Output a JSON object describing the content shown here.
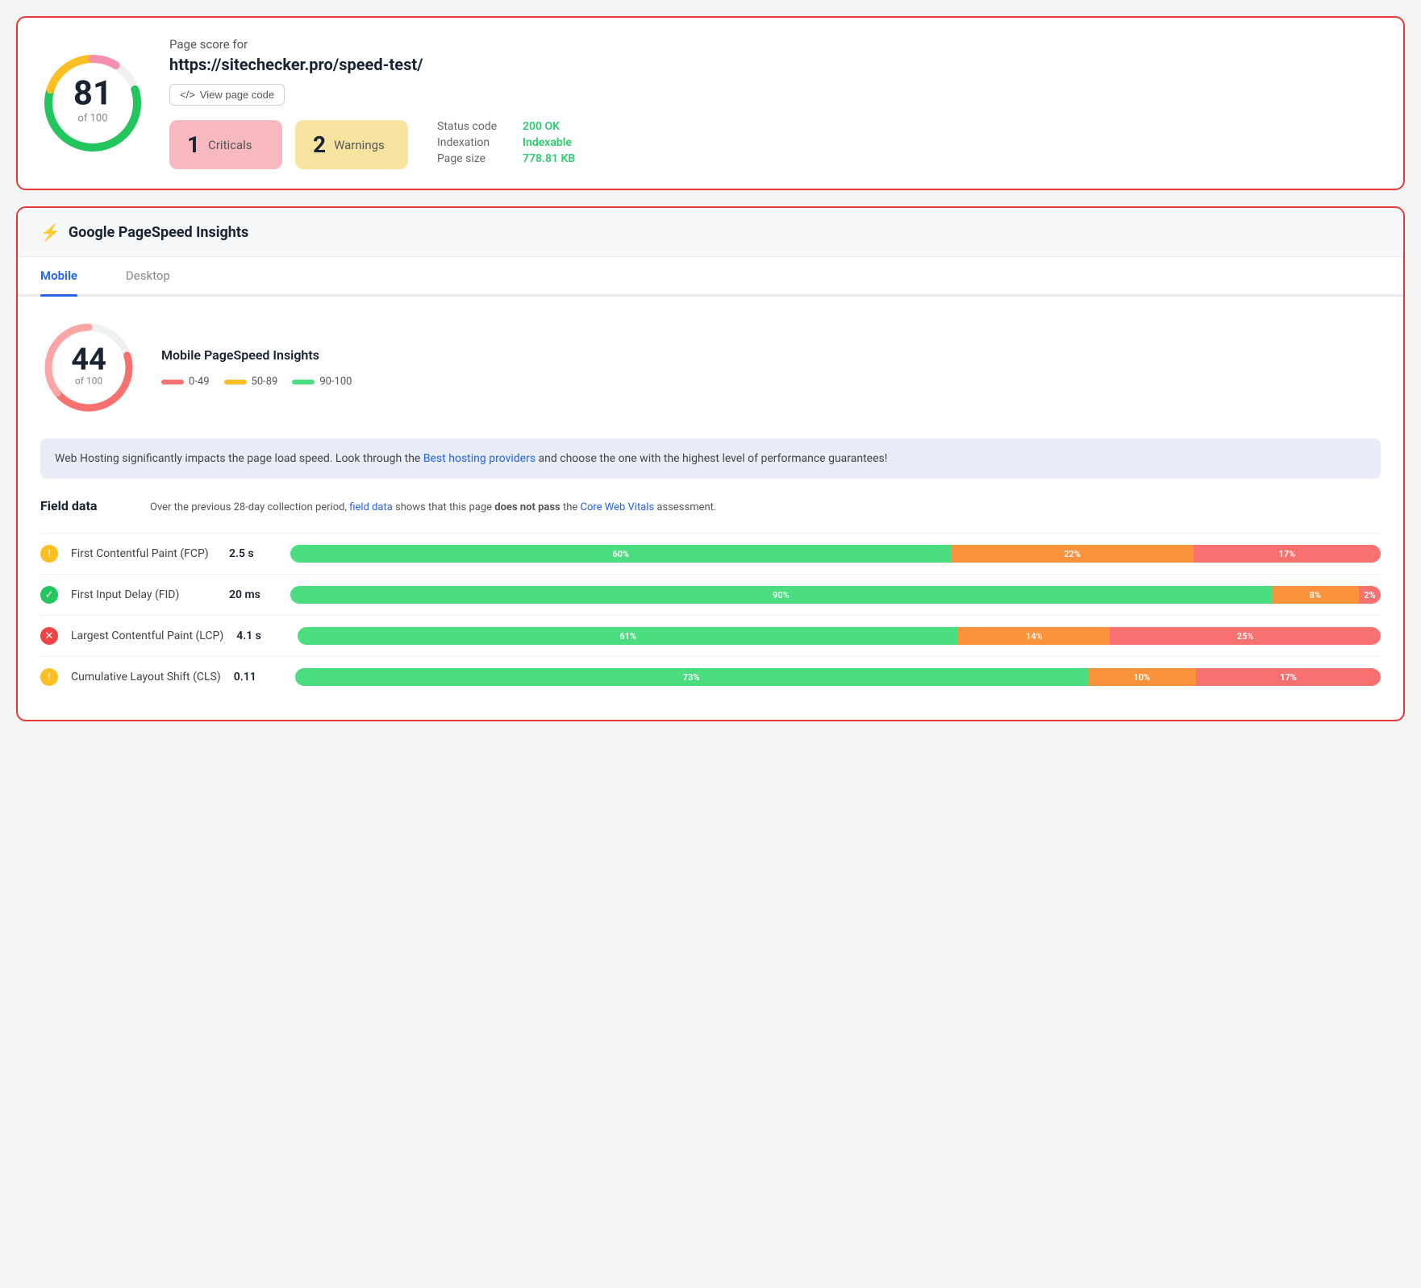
{
  "top_card": {
    "score": "81",
    "score_of": "of 100",
    "page_score_label": "Page score for",
    "page_url": "https://sitechecker.pro/speed-test/",
    "view_code_btn": "View page code",
    "criticals_count": "1",
    "criticals_label": "Criticals",
    "warnings_count": "2",
    "warnings_label": "Warnings",
    "status_code_label": "Status code",
    "status_code_value": "200 OK",
    "indexation_label": "Indexation",
    "indexation_value": "Indexable",
    "page_size_label": "Page size",
    "page_size_value": "778.81 KB"
  },
  "bottom_card": {
    "title": "Google PageSpeed Insights",
    "tabs": [
      {
        "label": "Mobile",
        "active": true
      },
      {
        "label": "Desktop",
        "active": false
      }
    ],
    "mobile_score": "44",
    "mobile_score_of": "of 100",
    "mobile_title": "Mobile PageSpeed Insights",
    "legend": [
      {
        "range": "0-49",
        "color": "#f87171"
      },
      {
        "range": "50-89",
        "color": "#fbbf24"
      },
      {
        "range": "90-100",
        "color": "#4ade80"
      }
    ],
    "info_box_text_1": "Web Hosting significantly impacts the page load speed. Look through the ",
    "info_box_link_text": "Best hosting providers",
    "info_box_text_2": " and choose the one with the highest level of performance guarantees!",
    "field_data_title": "Field data",
    "field_data_desc_1": "Over the previous 28-day collection period, ",
    "field_data_link": "field data",
    "field_data_desc_2": " shows that this page ",
    "field_data_bold": "does not pass",
    "field_data_desc_3": " the ",
    "field_data_link2": "Core Web Vitals",
    "field_data_desc_4": " assessment.",
    "metrics": [
      {
        "icon_type": "warning",
        "name": "First Contentful Paint (FCP)",
        "value": "2.5 s",
        "segments": [
          {
            "pct": 60,
            "label": "60%",
            "color": "green"
          },
          {
            "pct": 22,
            "label": "22%",
            "color": "orange"
          },
          {
            "pct": 17,
            "label": "17%",
            "color": "red"
          }
        ]
      },
      {
        "icon_type": "success",
        "name": "First Input Delay (FID)",
        "value": "20 ms",
        "segments": [
          {
            "pct": 90,
            "label": "90%",
            "color": "green"
          },
          {
            "pct": 8,
            "label": "8%",
            "color": "orange"
          },
          {
            "pct": 2,
            "label": "2%",
            "color": "red"
          }
        ]
      },
      {
        "icon_type": "error",
        "name": "Largest Contentful Paint (LCP)",
        "value": "4.1 s",
        "segments": [
          {
            "pct": 61,
            "label": "61%",
            "color": "green"
          },
          {
            "pct": 14,
            "label": "14%",
            "color": "orange"
          },
          {
            "pct": 25,
            "label": "25%",
            "color": "red"
          }
        ]
      },
      {
        "icon_type": "warning",
        "name": "Cumulative Layout Shift (CLS)",
        "value": "0.11",
        "segments": [
          {
            "pct": 73,
            "label": "73%",
            "color": "green"
          },
          {
            "pct": 10,
            "label": "10%",
            "color": "orange"
          },
          {
            "pct": 17,
            "label": "17%",
            "color": "red"
          }
        ]
      }
    ]
  }
}
